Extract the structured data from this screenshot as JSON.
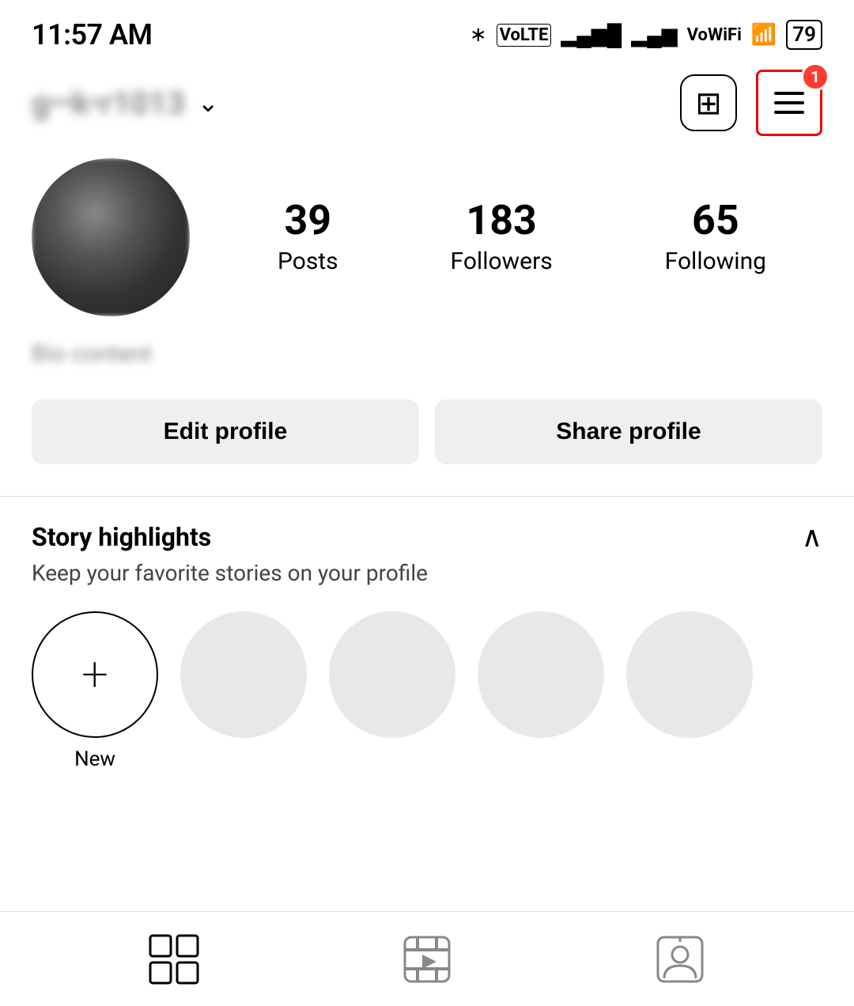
{
  "status_bar": {
    "time": "11:57 AM",
    "battery": "79"
  },
  "header": {
    "username": "g••••k•r1013",
    "add_post_icon": "+",
    "menu_icon": "≡",
    "notification_count": "1"
  },
  "profile": {
    "stats": [
      {
        "value": "39",
        "label": "Posts"
      },
      {
        "value": "183",
        "label": "Followers"
      },
      {
        "value": "65",
        "label": "Following"
      }
    ]
  },
  "buttons": {
    "edit_profile": "Edit profile",
    "share_profile": "Share profile"
  },
  "highlights": {
    "title": "Story highlights",
    "subtitle": "Keep your favorite stories on your profile",
    "new_label": "New",
    "chevron": "∧"
  },
  "bottom_tabs": [
    {
      "name": "grid-icon",
      "label": "Posts"
    },
    {
      "name": "reels-icon",
      "label": "Reels"
    },
    {
      "name": "tagged-icon",
      "label": "Tagged"
    }
  ]
}
